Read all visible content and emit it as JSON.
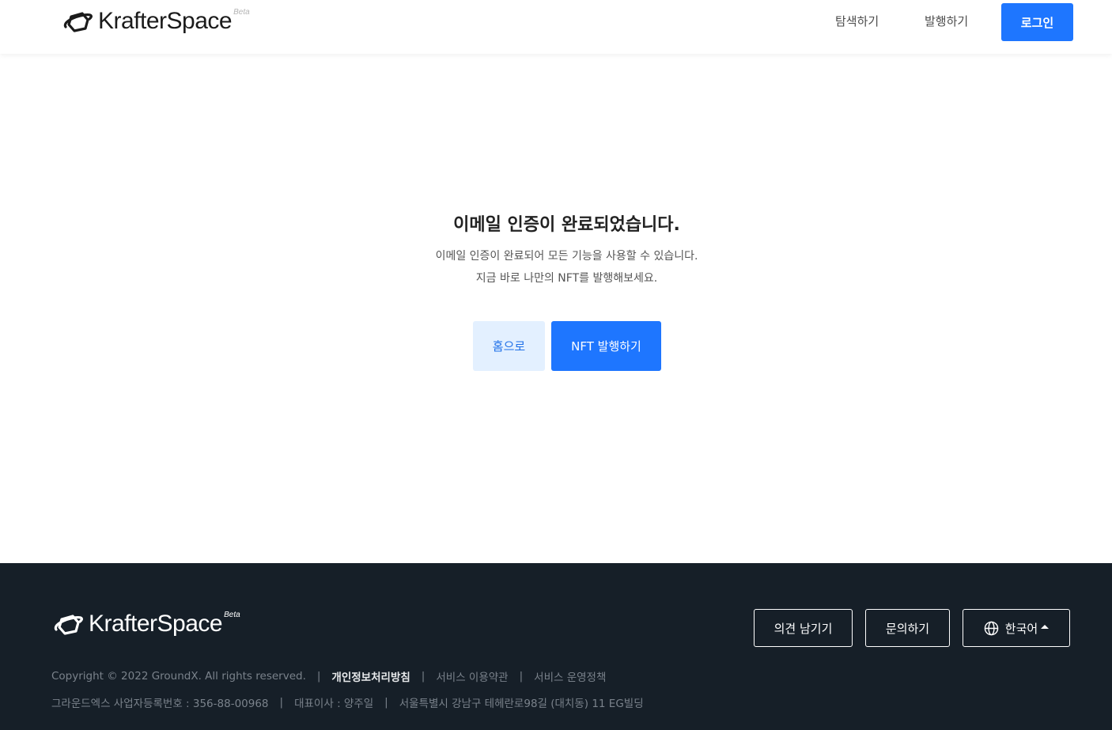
{
  "brand": {
    "name": "KrafterSpace",
    "beta": "Beta"
  },
  "header": {
    "nav": [
      "탐색하기",
      "발행하기"
    ],
    "login": "로그인"
  },
  "main": {
    "title": "이메일 인증이 완료되었습니다.",
    "description": [
      "이메일 인증이 완료되어 모든 기능을 사용할 수 있습니다.",
      "지금 바로 나만의 NFT를 발행해보세요."
    ],
    "buttons": {
      "home": "홈으로",
      "mint": "NFT 발행하기"
    }
  },
  "footer": {
    "buttons": {
      "feedback": "의견 남기기",
      "inquiry": "문의하기",
      "language": "한국어"
    },
    "copyright": "Copyright © 2022 GroundX. All rights reserved.",
    "links": [
      "개인정보처리방침",
      "서비스 이용약관",
      "서비스 운영정책"
    ],
    "company": {
      "registration": "그라운드엑스 사업자등록번호 : 356-88-00968",
      "ceo": "대표이사 : 양주일",
      "address": "서울특별시 강남구 테헤란로98길 (대치동) 11 EG빌딩"
    },
    "separator": "|"
  },
  "colors": {
    "primary": "#1e76ff",
    "primary_light": "#e3f0ff",
    "footer_bg": "#161f28",
    "text_muted": "#7a828b"
  },
  "icons": {
    "logo": "planet-ring-logo-icon",
    "language": "globe-icon",
    "language_toggle": "caret-up-icon"
  }
}
